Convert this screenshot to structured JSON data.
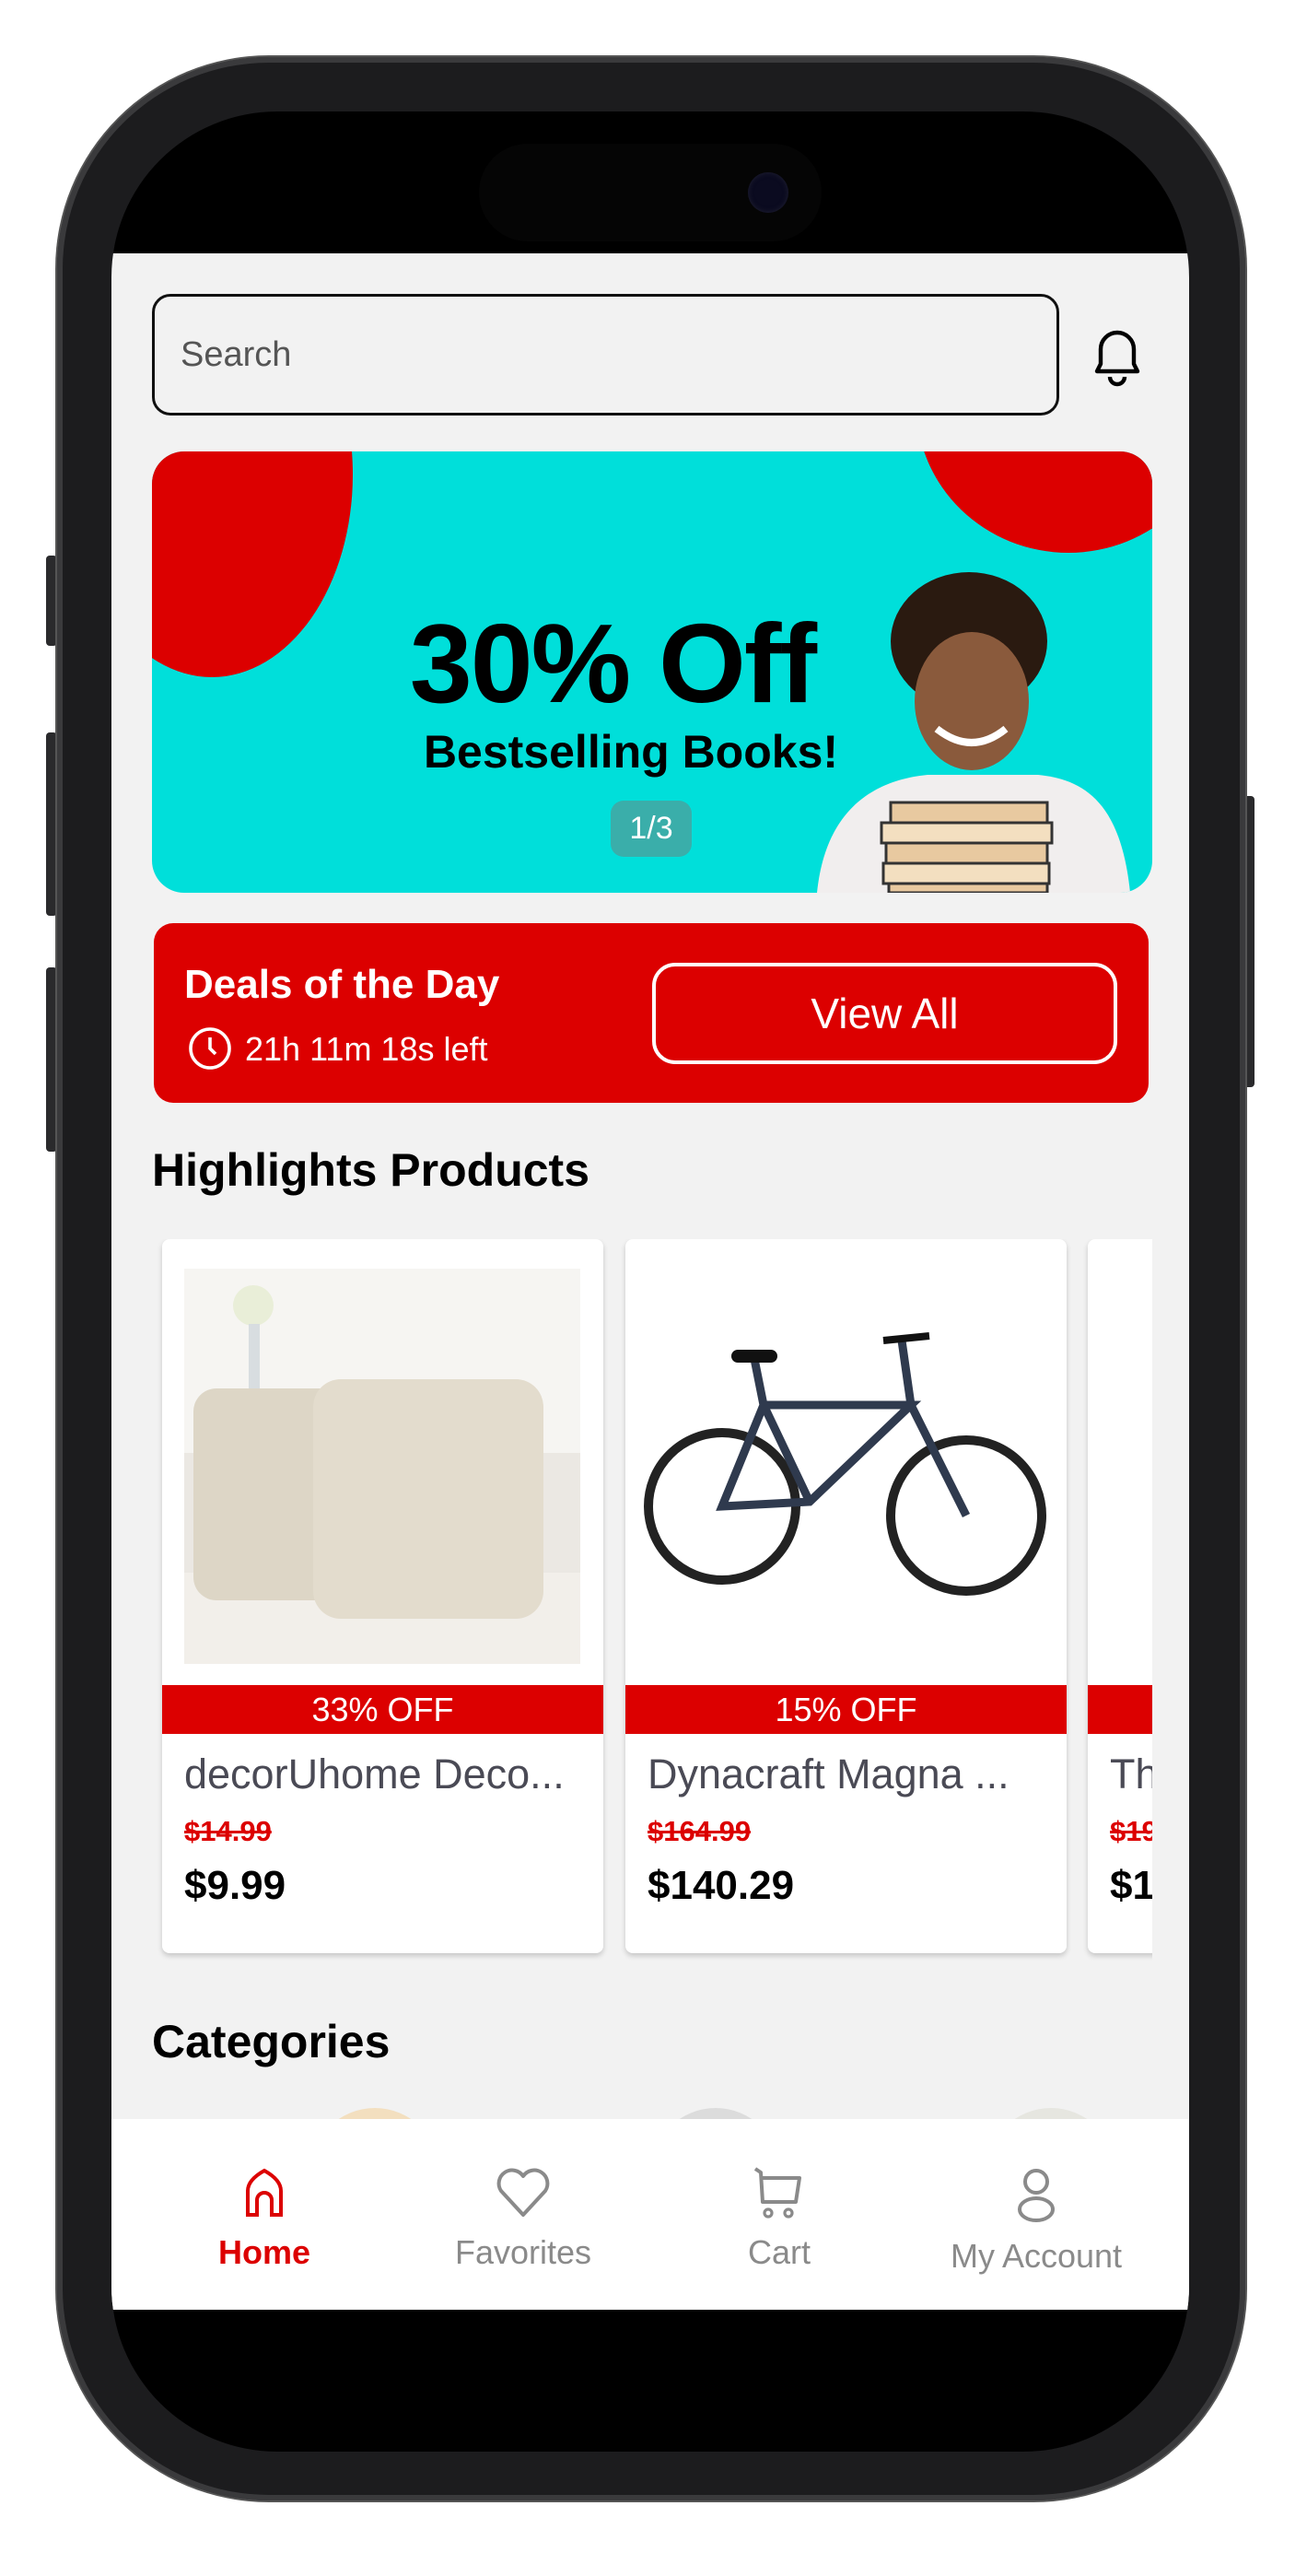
{
  "search": {
    "placeholder": "Search"
  },
  "icons": {
    "notification": "bell-icon",
    "timer": "clock-icon"
  },
  "banner": {
    "headline": "30% Off",
    "subline": "Bestselling Books!",
    "pager": "1/3"
  },
  "deals": {
    "title": "Deals of the Day",
    "countdown": "21h 11m 18s left",
    "button": "View All"
  },
  "highlights": {
    "title": "Highlights Products",
    "products": [
      {
        "discount": "33% OFF",
        "name": "decorUhome Deco...",
        "old_price": "$14.99",
        "price": "$9.99"
      },
      {
        "discount": "15% OFF",
        "name": "Dynacraft Magna ...",
        "old_price": "$164.99",
        "price": "$140.29"
      },
      {
        "discount": "",
        "name": "Th",
        "old_price": "$19",
        "price": "$1"
      }
    ]
  },
  "categories": {
    "title": "Categories"
  },
  "nav": {
    "items": [
      {
        "label": "Home",
        "active": true
      },
      {
        "label": "Favorites"
      },
      {
        "label": "Cart"
      },
      {
        "label": "My Account"
      }
    ]
  },
  "colors": {
    "accent": "#dc0000",
    "banner": "#00dfda",
    "background": "#f2f2f2"
  }
}
